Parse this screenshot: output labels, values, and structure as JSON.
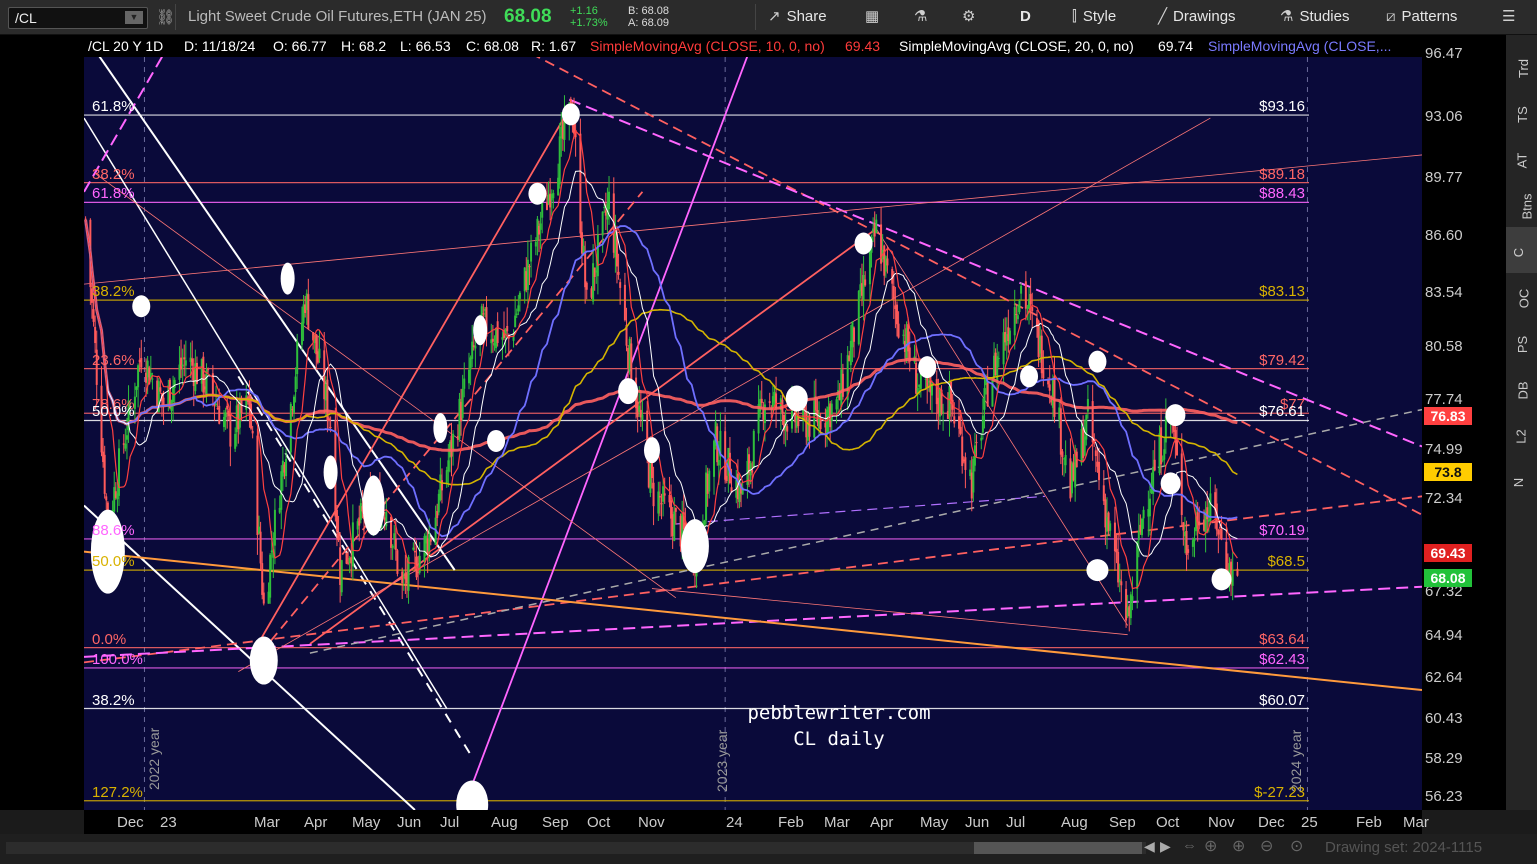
{
  "toolbar": {
    "symbol": "/CL",
    "instrument": "Light Sweet Crude Oil Futures,ETH (JAN 25)",
    "last": "68.08",
    "change": "+1.16",
    "change_pct": "+1.73%",
    "bid": "B: 68.08",
    "ask": "A: 68.09",
    "share": "Share",
    "period": "D",
    "style": "Style",
    "drawings": "Drawings",
    "studies": "Studies",
    "patterns": "Patterns"
  },
  "info": {
    "symbol_period": "/CL 20 Y 1D",
    "date": "D: 11/18/24",
    "open": "O: 66.77",
    "high": "H: 68.2",
    "low": "L: 66.53",
    "close": "C: 68.08",
    "range": "R: 1.67",
    "sma10_label": "SimpleMovingAvg (CLOSE, 10, 0, no)",
    "sma10_value": "69.43",
    "sma20_label": "SimpleMovingAvg (CLOSE, 20, 0, no)",
    "sma20_value": "69.74",
    "sma_other_label": "SimpleMovingAvg (CLOSE,..."
  },
  "sidebar": [
    "Trd",
    "TS",
    "AT",
    "Btns",
    "C",
    "OC",
    "PS",
    "DB",
    "L2",
    "N"
  ],
  "colors": {
    "background": "#0a0a3a",
    "up": "#2fbf3b",
    "down": "#ff5a5a",
    "sma10": "#ff4040",
    "sma20": "#ffffff",
    "sma50": "#6f6fff",
    "sma100": "#d4b400",
    "sma200": "#ff6060",
    "fib_white": "#ffffff",
    "fib_yellow": "#d9b200",
    "fib_magenta": "#ff66ff",
    "fib_red": "#ff6666",
    "trend_orange": "#ff9a3c"
  },
  "fib_levels_left": [
    {
      "label": "61.8%",
      "price": 93.16,
      "color": "#ffffff"
    },
    {
      "label": "38.2%",
      "price": 89.5,
      "color": "#ff6666"
    },
    {
      "label": "61.8%",
      "price": 88.43,
      "color": "#ff66ff"
    },
    {
      "label": "38.2%",
      "price": 83.13,
      "color": "#d9b200"
    },
    {
      "label": "23.6%",
      "price": 79.42,
      "color": "#ff6666"
    },
    {
      "label": "78.6%",
      "price": 77.0,
      "color": "#ff6666"
    },
    {
      "label": "50.0%",
      "price": 76.61,
      "color": "#ffffff"
    },
    {
      "label": "88.6%",
      "price": 70.19,
      "color": "#ff66ff"
    },
    {
      "label": "50.0%",
      "price": 68.5,
      "color": "#d9b200"
    },
    {
      "label": "0.0%",
      "price": 64.3,
      "color": "#ff6666"
    },
    {
      "label": "100.0%",
      "price": 63.2,
      "color": "#ff66ff"
    },
    {
      "label": "38.2%",
      "price": 61.0,
      "color": "#ffffff"
    },
    {
      "label": "127.2%",
      "price": 56.0,
      "color": "#d9b200"
    }
  ],
  "fib_levels_right": [
    {
      "label": "$93.16",
      "price": 93.16,
      "color": "#ffffff"
    },
    {
      "label": "$89.18",
      "price": 89.5,
      "color": "#ff6666"
    },
    {
      "label": "$88.43",
      "price": 88.43,
      "color": "#ff66ff"
    },
    {
      "label": "$83.13",
      "price": 83.13,
      "color": "#d9b200"
    },
    {
      "label": "$79.42",
      "price": 79.42,
      "color": "#ff6666"
    },
    {
      "label": "$77",
      "price": 77.0,
      "color": "#ff6666"
    },
    {
      "label": "$76.61",
      "price": 76.61,
      "color": "#ffffff"
    },
    {
      "label": "$70.19",
      "price": 70.19,
      "color": "#ff66ff"
    },
    {
      "label": "$68.5",
      "price": 68.5,
      "color": "#d9b200"
    },
    {
      "label": "$63.64",
      "price": 64.3,
      "color": "#ff6666"
    },
    {
      "label": "$62.43",
      "price": 63.2,
      "color": "#ff66ff"
    },
    {
      "label": "$60.07",
      "price": 61.0,
      "color": "#ffffff"
    },
    {
      "label": "$-27.23",
      "price": 56.0,
      "color": "#d9b200"
    }
  ],
  "watermark": {
    "line1": "pebblewriter.com",
    "line2": "CL daily"
  },
  "year_marks": [
    "2022 year",
    "2023 year",
    "2024 year"
  ],
  "drawing_set": "Drawing set: 2024-1115",
  "price_boxes": [
    {
      "label": "76.83",
      "price": 76.83,
      "bg": "#ff4040",
      "fg": "#ffffff"
    },
    {
      "label": "73.8",
      "price": 73.8,
      "bg": "#ffcc00",
      "fg": "#111111"
    },
    {
      "label": "69.43",
      "price": 69.43,
      "bg": "#e02020",
      "fg": "#ffffff"
    },
    {
      "label": "68.08",
      "price": 68.08,
      "bg": "#22c23a",
      "fg": "#ffffff"
    }
  ],
  "chart_data": {
    "type": "candlestick",
    "symbol": "/CL",
    "ylim": [
      55.5,
      97.5
    ],
    "y_ticks": [
      96.47,
      93.06,
      89.77,
      86.6,
      83.54,
      80.58,
      77.74,
      74.99,
      72.34,
      67.32,
      64.94,
      62.64,
      60.43,
      58.29,
      56.23
    ],
    "x_labels": [
      "Dec",
      "23",
      "Mar",
      "Apr",
      "May",
      "Jun",
      "Jul",
      "Aug",
      "Sep",
      "Oct",
      "Nov",
      "24",
      "Feb",
      "Mar",
      "Apr",
      "May",
      "Jun",
      "Jul",
      "Aug",
      "Sep",
      "Oct",
      "Nov",
      "Dec",
      "25",
      "Feb",
      "Mar"
    ],
    "x_range": [
      "2022-11-24",
      "2025-03-14"
    ],
    "close_path": [
      [
        "2022-11-25",
        87.5
      ],
      [
        "2022-12-09",
        71.0
      ],
      [
        "2022-12-30",
        80.3
      ],
      [
        "2023-01-13",
        77.5
      ],
      [
        "2023-01-27",
        80.0
      ],
      [
        "2023-02-10",
        78.5
      ],
      [
        "2023-02-24",
        76.0
      ],
      [
        "2023-03-08",
        77.5
      ],
      [
        "2023-03-17",
        66.5
      ],
      [
        "2023-03-31",
        75.5
      ],
      [
        "2023-04-12",
        83.3
      ],
      [
        "2023-04-28",
        76.5
      ],
      [
        "2023-05-04",
        68.5
      ],
      [
        "2023-05-19",
        71.5
      ],
      [
        "2023-06-02",
        72.0
      ],
      [
        "2023-06-12",
        67.5
      ],
      [
        "2023-06-30",
        70.5
      ],
      [
        "2023-07-14",
        75.5
      ],
      [
        "2023-07-31",
        81.8
      ],
      [
        "2023-08-18",
        81.0
      ],
      [
        "2023-09-05",
        86.7
      ],
      [
        "2023-09-27",
        93.7
      ],
      [
        "2023-10-06",
        82.8
      ],
      [
        "2023-10-20",
        88.5
      ],
      [
        "2023-11-01",
        80.5
      ],
      [
        "2023-11-16",
        72.9
      ],
      [
        "2023-12-13",
        69.5
      ],
      [
        "2023-12-26",
        75.5
      ],
      [
        "2024-01-12",
        72.5
      ],
      [
        "2024-01-26",
        78.0
      ],
      [
        "2024-02-09",
        76.8
      ],
      [
        "2024-02-23",
        76.5
      ],
      [
        "2024-03-12",
        77.5
      ],
      [
        "2024-04-05",
        86.9
      ],
      [
        "2024-04-17",
        82.7
      ],
      [
        "2024-05-03",
        78.1
      ],
      [
        "2024-05-22",
        77.5
      ],
      [
        "2024-06-04",
        73.3
      ],
      [
        "2024-06-14",
        78.4
      ],
      [
        "2024-07-05",
        83.9
      ],
      [
        "2024-07-25",
        78.3
      ],
      [
        "2024-08-05",
        72.9
      ],
      [
        "2024-08-16",
        76.7
      ],
      [
        "2024-09-10",
        65.5
      ],
      [
        "2024-09-20",
        71.9
      ],
      [
        "2024-10-07",
        77.1
      ],
      [
        "2024-10-18",
        69.2
      ],
      [
        "2024-10-25",
        71.8
      ],
      [
        "2024-11-04",
        71.5
      ],
      [
        "2024-11-13",
        68.4
      ],
      [
        "2024-11-18",
        68.08
      ]
    ],
    "moving_averages": [
      {
        "name": "SimpleMovingAvg (CLOSE, 10, 0, no)",
        "last": 69.43
      },
      {
        "name": "SimpleMovingAvg (CLOSE, 20, 0, no)",
        "last": 69.74
      },
      {
        "name": "SimpleMovingAvg (CLOSE,...",
        "last": 73.8
      },
      {
        "name": "SimpleMovingAvg (CLOSE,...",
        "last": 76.83
      }
    ],
    "last_bar": {
      "date": "2024-11-18",
      "open": 66.77,
      "high": 68.2,
      "low": 66.53,
      "close": 68.08
    }
  }
}
